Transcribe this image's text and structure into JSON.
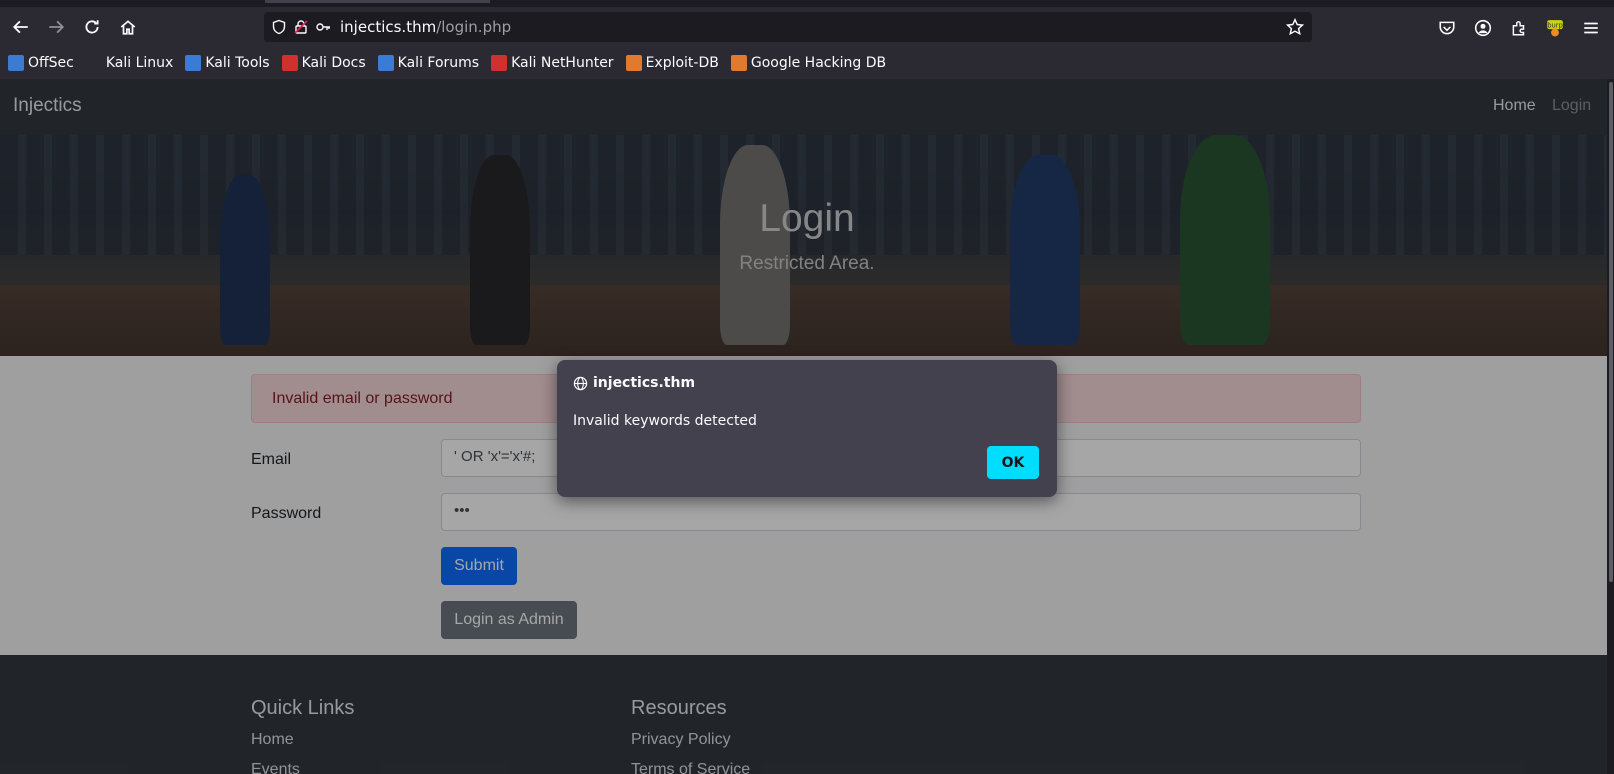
{
  "browser": {
    "url_host": "injectics.thm",
    "url_path": "/login.php",
    "bookmarks": [
      {
        "label": "OffSec",
        "color": "#3a7bd5"
      },
      {
        "label": "Kali Linux",
        "color": "#2b2a33"
      },
      {
        "label": "Kali Tools",
        "color": "#3a7bd5"
      },
      {
        "label": "Kali Docs",
        "color": "#d0312d"
      },
      {
        "label": "Kali Forums",
        "color": "#3a7bd5"
      },
      {
        "label": "Kali NetHunter",
        "color": "#d0312d"
      },
      {
        "label": "Exploit-DB",
        "color": "#e07a2e"
      },
      {
        "label": "Google Hacking DB",
        "color": "#e07a2e"
      }
    ],
    "icons": [
      "back-icon",
      "forward-icon",
      "reload-icon",
      "home-icon",
      "shield-icon",
      "lock-icon",
      "key-icon",
      "star-icon",
      "pocket-icon",
      "account-icon",
      "extensions-icon",
      "burp-icon",
      "menu-icon"
    ]
  },
  "site": {
    "brand": "Injectics",
    "nav": {
      "home": "Home",
      "login": "Login"
    },
    "hero": {
      "title": "Login",
      "subtitle": "Restricted Area."
    },
    "alert": "Invalid email or password",
    "form": {
      "email_label": "Email",
      "email_value": "' OR 'x'='x'#;",
      "password_label": "Password",
      "password_value": "•••",
      "submit_label": "Submit",
      "admin_label": "Login as Admin"
    },
    "footer": {
      "quick_links_title": "Quick Links",
      "quick_links": [
        "Home",
        "Events"
      ],
      "resources_title": "Resources",
      "resources": [
        "Privacy Policy",
        "Terms of Service"
      ]
    }
  },
  "dialog": {
    "origin": "injectics.thm",
    "message": "Invalid keywords detected",
    "ok_label": "OK"
  },
  "colors": {
    "accent_ok": "#00ddff",
    "submit": "#0d6efd",
    "admin": "#6c757d",
    "navbar": "#343a40",
    "alert_bg": "#f8d7da"
  }
}
